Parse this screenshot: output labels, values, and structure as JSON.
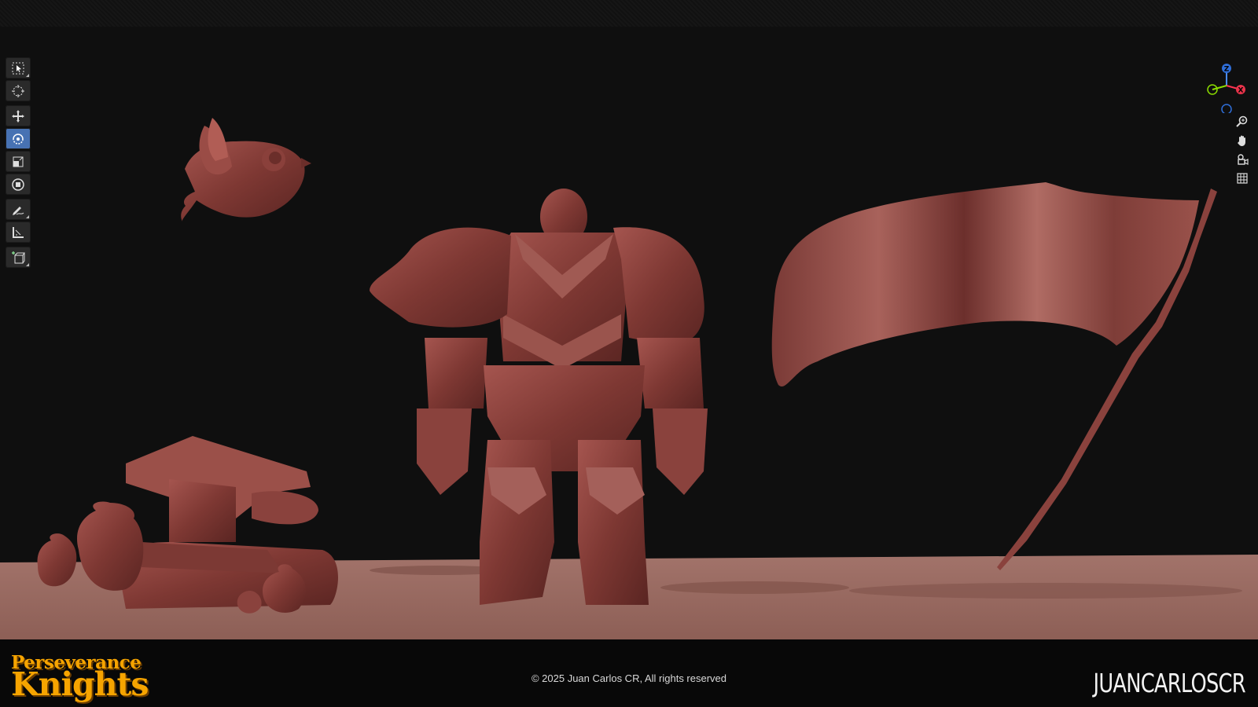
{
  "footer": {
    "logo_line1": "Perseverance",
    "logo_line2": "Knights",
    "copyright": "© 2025 Juan Carlos CR, All rights reserved",
    "author": "JUANCARLOSCR"
  },
  "toolbar": {
    "tools": [
      {
        "name": "select-box",
        "icon": "select-box-icon",
        "active": false
      },
      {
        "name": "cursor",
        "icon": "cursor-icon",
        "active": false
      },
      {
        "name": "move",
        "icon": "move-icon",
        "active": false
      },
      {
        "name": "rotate",
        "icon": "rotate-icon",
        "active": true
      },
      {
        "name": "scale",
        "icon": "scale-icon",
        "active": false
      },
      {
        "name": "transform",
        "icon": "transform-icon",
        "active": false
      },
      {
        "name": "annotate",
        "icon": "annotate-icon",
        "active": false
      },
      {
        "name": "measure",
        "icon": "measure-icon",
        "active": false
      },
      {
        "name": "add-cube",
        "icon": "add-cube-icon",
        "active": false
      }
    ]
  },
  "gizmo": {
    "z": "Z",
    "x": "X"
  },
  "nav": {
    "icons": [
      "zoom-icon",
      "pan-hand-icon",
      "camera-icon",
      "grid-icon"
    ]
  },
  "colors": {
    "accent": "#4772b3",
    "clay": "#8a3f3a",
    "ground": "#9a6a60",
    "logo": "#f6a400"
  }
}
